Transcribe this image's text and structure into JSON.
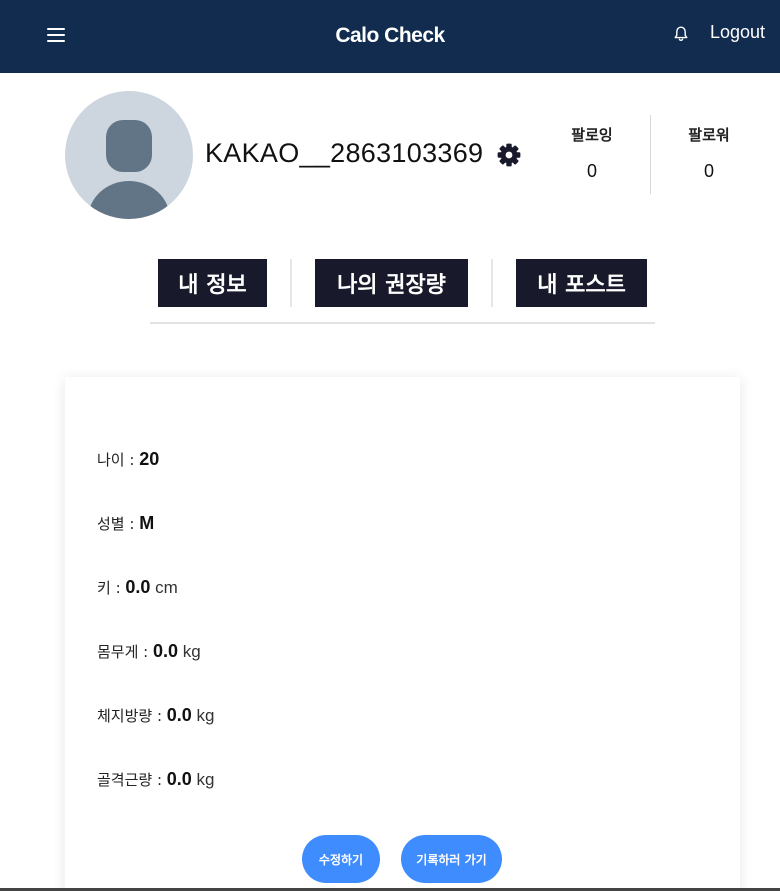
{
  "header": {
    "title": "Calo Check",
    "logout_label": "Logout",
    "menu_icon": "hamburger-icon",
    "notification_icon": "bell-icon",
    "background_color": "#112c4f"
  },
  "profile": {
    "username": "KAKAO__2863103369",
    "settings_icon": "gear-icon",
    "following_label": "팔로잉",
    "following_count": "0",
    "followers_label": "팔로워",
    "followers_count": "0"
  },
  "tabs": [
    {
      "label": "내 정보"
    },
    {
      "label": "나의 권장량"
    },
    {
      "label": "내 포스트"
    }
  ],
  "info": {
    "age": {
      "label": "나이 : ",
      "value": "20",
      "unit": ""
    },
    "gender": {
      "label": "성별 : ",
      "value": "M",
      "unit": ""
    },
    "height": {
      "label": "키 : ",
      "value": "0.0",
      "unit": " cm"
    },
    "weight": {
      "label": "몸무게 : ",
      "value": "0.0",
      "unit": " kg"
    },
    "body_fat": {
      "label": "체지방량 : ",
      "value": "0.0",
      "unit": " kg"
    },
    "muscle": {
      "label": "골격근량 : ",
      "value": "0.0",
      "unit": " kg"
    }
  },
  "actions": {
    "edit_label": "수정하기",
    "record_label": "기록하러 가기",
    "accent_color": "#3f8cff"
  }
}
